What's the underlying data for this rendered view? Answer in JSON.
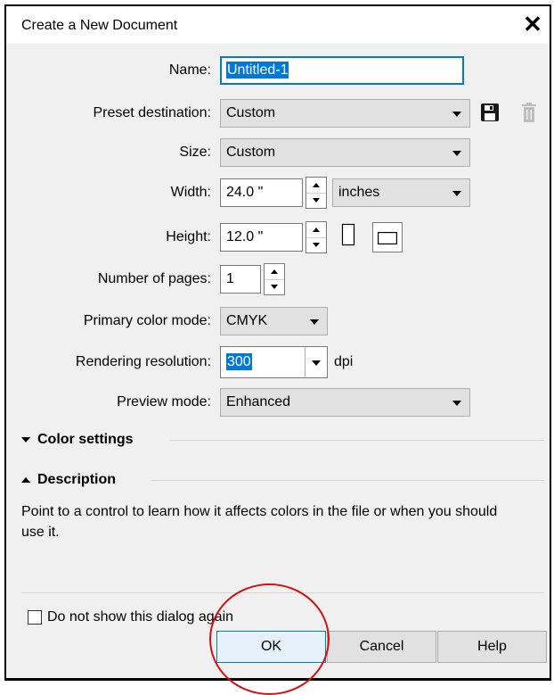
{
  "dialog": {
    "title": "Create a New Document",
    "close_glyph": "✕"
  },
  "fields": {
    "name": {
      "label": "Name:",
      "value": "Untitled-1"
    },
    "preset": {
      "label": "Preset destination:",
      "value": "Custom",
      "save_icon": "save-preset-icon",
      "delete_icon": "delete-preset-icon"
    },
    "size": {
      "label": "Size:",
      "value": "Custom"
    },
    "width": {
      "label": "Width:",
      "value": "24.0 \"",
      "unit": "inches"
    },
    "height": {
      "label": "Height:",
      "value": "12.0 \"",
      "orientation_icons": [
        "portrait-icon",
        "landscape-icon"
      ]
    },
    "pages": {
      "label": "Number of pages:",
      "value": "1"
    },
    "color_mode": {
      "label": "Primary color mode:",
      "value": "CMYK"
    },
    "resolution": {
      "label": "Rendering resolution:",
      "value": "300",
      "unit": "dpi"
    },
    "preview": {
      "label": "Preview mode:",
      "value": "Enhanced"
    }
  },
  "sections": {
    "color_settings": "Color settings",
    "description": "Description",
    "description_text": "Point to a control to learn how it affects colors in the file or when you should use it."
  },
  "footer": {
    "dont_show_label": "Do not show this dialog again",
    "dont_show_checked": false,
    "ok": "OK",
    "cancel": "Cancel",
    "help": "Help"
  },
  "annotation": {
    "color": "#d61010"
  }
}
